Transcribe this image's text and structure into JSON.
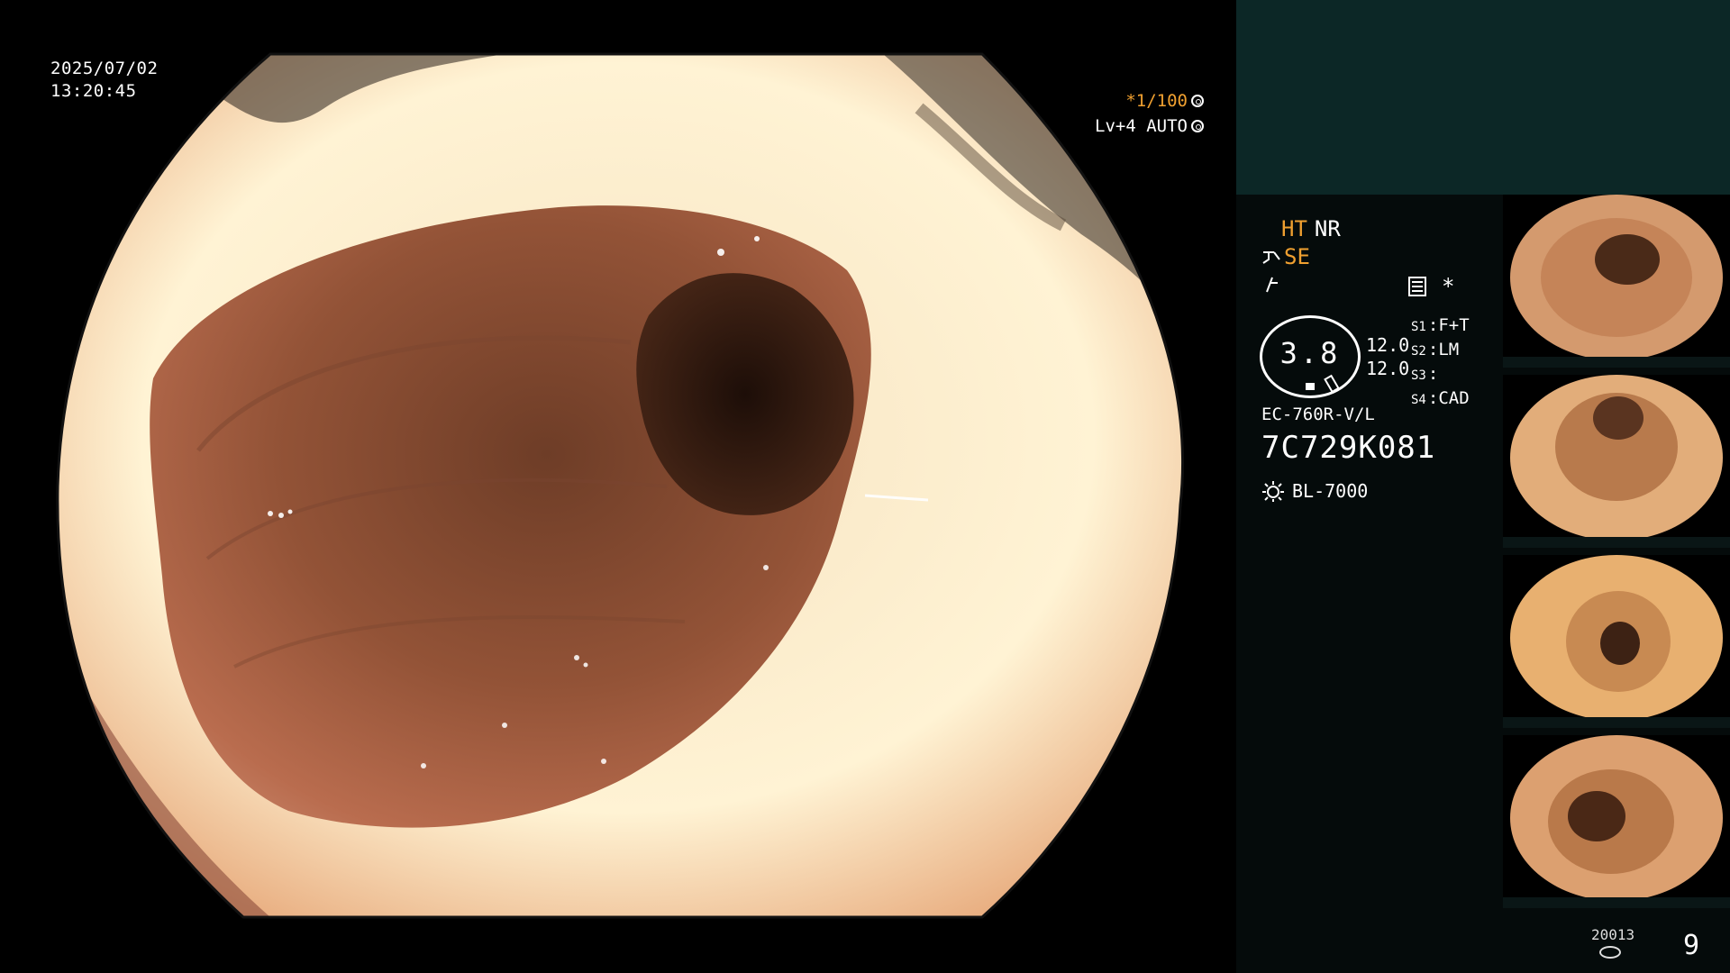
{
  "overlay": {
    "date": "2025/07/02",
    "time": "13:20:45",
    "shutter_value": "*1/100",
    "level_label": "Lv+4 AUTO"
  },
  "status": {
    "ht": "HT",
    "nr": "NR",
    "se": "SE",
    "gauge_value": "3.8",
    "val_top": "12.0",
    "val_bottom": "12.0",
    "s1_key": "S1",
    "s1_val": "F+T",
    "s2_key": "S2",
    "s2_val": "LM",
    "s3_key": "S3",
    "s3_val": "",
    "s4_key": "S4",
    "s4_val": "CAD",
    "model": "EC-760R-V/L",
    "serial": "7C729K081",
    "light_source": "BL-7000",
    "star": "*"
  },
  "footer": {
    "db_number": "20013",
    "page": "9"
  },
  "thumbnails": [
    {
      "label": "thumbnail-1"
    },
    {
      "label": "thumbnail-2"
    },
    {
      "label": "thumbnail-3"
    },
    {
      "label": "thumbnail-4"
    }
  ],
  "colors": {
    "accent": "#f0a030",
    "panel_top": "#0c2726",
    "panel": "#050b0b"
  },
  "icons": [
    "shutter-dial-icon",
    "auto-ring-icon",
    "scope-icon",
    "flash-icon",
    "menu-icon",
    "sun-light-icon",
    "database-icon"
  ]
}
